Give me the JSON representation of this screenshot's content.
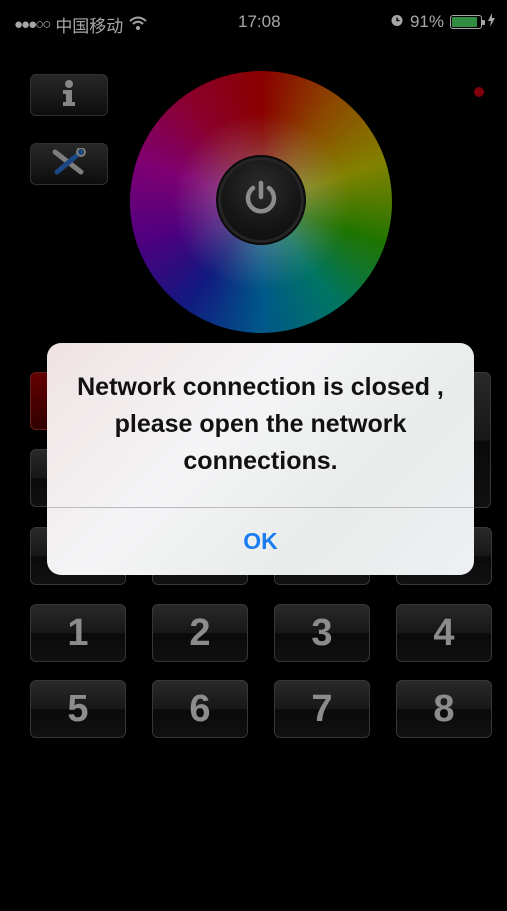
{
  "status_bar": {
    "signal": "●●●○○",
    "carrier": "中国移动",
    "wifi_icon": "wifi-icon",
    "time": "17:08",
    "alarm_icon": "alarm-clock-icon",
    "battery_text": "91%",
    "battery_level": 0.91,
    "charging_icon": "charging-bolt-icon"
  },
  "toolbar": {
    "info_icon": "info-icon",
    "settings_icon": "tools-icon"
  },
  "color_wheel": {
    "power_icon": "power-icon",
    "indicator_color": "#c00010"
  },
  "zone_keys": {
    "row1": [
      "1",
      "2",
      "3",
      "4"
    ],
    "row2": [
      "5",
      "6",
      "7",
      "8"
    ]
  },
  "alert": {
    "message": "Network connection is closed , please open the network connections.",
    "ok_label": "OK"
  },
  "colors": {
    "alert_button": "#1a7cf2",
    "background": "#000000"
  }
}
